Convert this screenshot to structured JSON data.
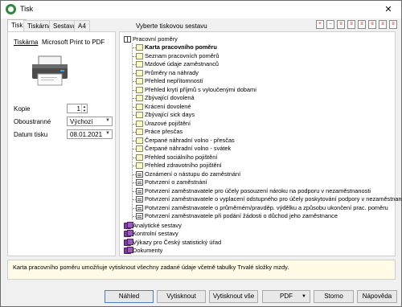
{
  "window": {
    "title": "Tisk",
    "close_glyph": "✕"
  },
  "tabs": [
    "Tisk",
    "Tiskárna",
    "Sestava",
    "A4"
  ],
  "left": {
    "printer_label": "Tiskárna",
    "printer_name": "Microsoft Print to PDF",
    "copies_label": "Kopie",
    "copies_value": "1",
    "sides_label": "Oboustranné",
    "sides_value": "Výchozí",
    "date_label": "Datum tisku",
    "date_value": "08.01.2021"
  },
  "header": {
    "prompt": "Vyberte tiskovou sestavu"
  },
  "toolbar": {
    "buttons": [
      {
        "icon": "expand-icon",
        "glyph": "+"
      },
      {
        "icon": "collapse-icon",
        "glyph": "−"
      },
      {
        "icon": "doc-icon",
        "glyph": "≡"
      },
      {
        "icon": "doc-icon",
        "glyph": "≡"
      },
      {
        "icon": "doc-icon",
        "glyph": "≡"
      },
      {
        "icon": "doc-icon",
        "glyph": "≡"
      },
      {
        "icon": "doc-icon",
        "glyph": "≡"
      },
      {
        "icon": "doc-icon",
        "glyph": "≡"
      }
    ]
  },
  "tree": {
    "root": "Pracovní poměry",
    "items": [
      {
        "label": "Karta pracovního poměru",
        "icon": "doc",
        "selected": true
      },
      {
        "label": "Seznam pracovních poměrů",
        "icon": "doc"
      },
      {
        "label": "Mzdové údaje zaměstnanců",
        "icon": "doc"
      },
      {
        "label": "Průměry na náhrady",
        "icon": "doc"
      },
      {
        "label": "Přehled nepřítomností",
        "icon": "doc"
      },
      {
        "label": "Přehled krytí příjmů s vyloučenými dobami",
        "icon": "doc"
      },
      {
        "label": "Zbývající dovolená",
        "icon": "doc"
      },
      {
        "label": "Krácení dovolené",
        "icon": "doc"
      },
      {
        "label": "Zbývající sick days",
        "icon": "doc"
      },
      {
        "label": "Úrazové pojištění",
        "icon": "doc"
      },
      {
        "label": "Práce přesčas",
        "icon": "doc"
      },
      {
        "label": "Čerpané náhradní volno - přesčas",
        "icon": "doc"
      },
      {
        "label": "Čerpané náhradní volno - svátek",
        "icon": "doc"
      },
      {
        "label": "Přehled sociálního pojištění",
        "icon": "doc"
      },
      {
        "label": "Přehled zdravotního pojištění",
        "icon": "doc"
      },
      {
        "label": "Oznámení o nástupu do zaměstnání",
        "icon": "file"
      },
      {
        "label": "Potvrzení o zaměstnání",
        "icon": "file"
      },
      {
        "label": "Potvrzení zaměstnavatele pro účely posouzení nároku na podporu v nezaměstnanosti",
        "icon": "file"
      },
      {
        "label": "Potvrzení zaměstnavatele o vyplacení odstupného pro účely poskytování podpory v nezaměstnanosti",
        "icon": "file"
      },
      {
        "label": "Potvrzení zaměstnavatele o průměrném/pravděp. výdělku a způsobu ukončení prac. poměru",
        "icon": "file"
      },
      {
        "label": "Potvrzení zaměstnavatele při podání žádosti o důchod jeho zaměstnance",
        "icon": "file"
      }
    ],
    "groups": [
      "Analytické sestavy",
      "Kontrolní sestavy",
      "Výkazy pro Český statistický úřad",
      "Dokumenty"
    ]
  },
  "description": "Karta pracovního poměru umožňuje vytisknout všechny zadané údaje včetně tabulky Trvalé složky mzdy.",
  "buttons": {
    "preview": "Náhled",
    "print": "Vytisknout",
    "print_all": "Vytisknout vše",
    "pdf": "PDF",
    "cancel": "Storno",
    "help": "Nápověda"
  }
}
